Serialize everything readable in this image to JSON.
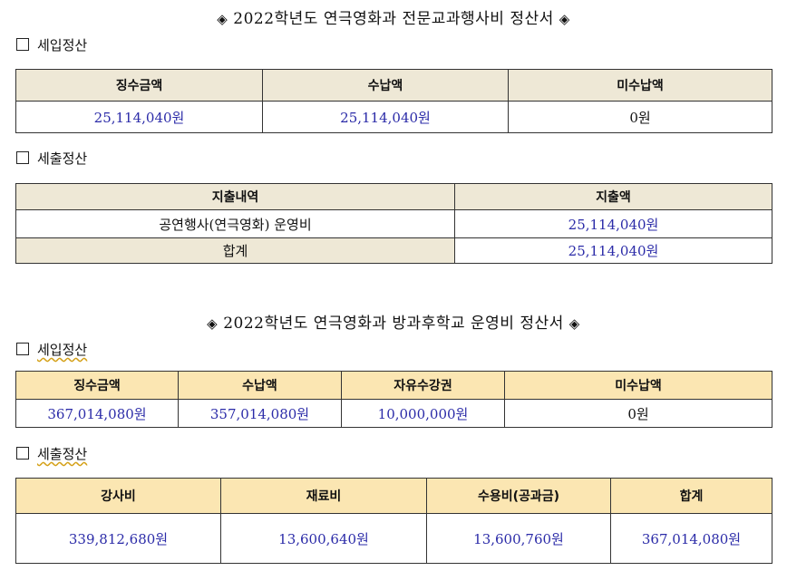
{
  "doc1": {
    "title": "2022학년도 연극영화과 전문교과행사비 정산서",
    "income_label": "세입정산",
    "income_table": {
      "headers": [
        "징수금액",
        "수납액",
        "미수납액"
      ],
      "row": [
        "25,114,040원",
        "25,114,040원",
        "0원"
      ]
    },
    "expense_label": "세출정산",
    "expense_table": {
      "headers": [
        "지출내역",
        "지출액"
      ],
      "rows": [
        [
          "공연행사(연극영화) 운영비",
          "25,114,040원"
        ],
        [
          "합계",
          "25,114,040원"
        ]
      ]
    }
  },
  "doc2": {
    "title": "2022학년도 연극영화과 방과후학교 운영비 정산서",
    "income_label": "세입정산",
    "income_table": {
      "headers": [
        "징수금액",
        "수납액",
        "자유수강권",
        "미수납액"
      ],
      "row": [
        "367,014,080원",
        "357,014,080원",
        "10,000,000원",
        "0원"
      ]
    },
    "expense_label": "세출정산",
    "expense_table": {
      "headers": [
        "강사비",
        "재료비",
        "수용비(공과금)",
        "합계"
      ],
      "row": [
        "339,812,680원",
        "13,600,640원",
        "13,600,760원",
        "367,014,080원"
      ]
    }
  },
  "icons": {
    "title_bullet": "diamond-bullet-icon",
    "section_bullet": "checkbox-square-icon"
  }
}
